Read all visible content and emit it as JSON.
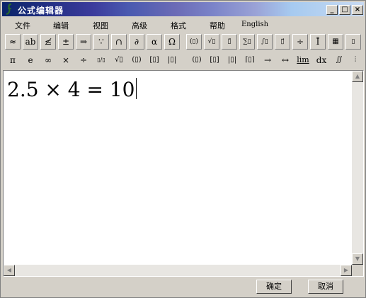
{
  "window": {
    "title": "公式编辑器",
    "min_glyph": "_",
    "max_glyph": "□",
    "close_glyph": "×"
  },
  "menu": [
    "文件",
    "编辑",
    "视图",
    "高级",
    "格式",
    "帮助",
    "English"
  ],
  "toolbar1": [
    "≈",
    "ab",
    "≰",
    "±",
    "⇒",
    "∵",
    "∩",
    "∂",
    "α",
    "Ω",
    "(▯)",
    "√▯",
    "▯̈",
    "∑▯",
    "∫▯",
    "▯⃗",
    "÷",
    "Ī",
    "▦",
    "▯"
  ],
  "toolbar2": [
    "π",
    "e",
    "∞",
    "×",
    "÷",
    "▯/▯",
    "√▯",
    "(▯)",
    "[▯]",
    "|▯|",
    "(▯)",
    "[▯]",
    "|▯|",
    "⌈▯⌉",
    "→",
    "↔",
    "lim",
    "dx",
    "∬",
    "⫶"
  ],
  "editor": {
    "formula": "2.5 × 4 = 10"
  },
  "buttons": {
    "ok": "确定",
    "cancel": "取消"
  }
}
